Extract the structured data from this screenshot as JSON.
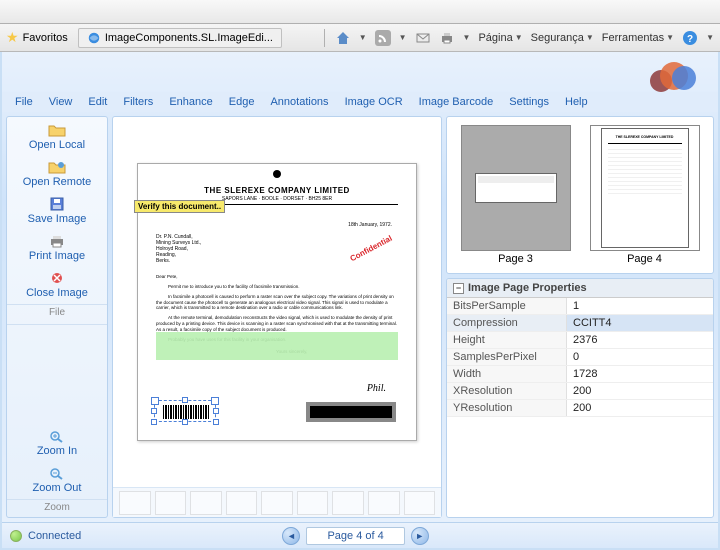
{
  "browser": {
    "favorites_label": "Favoritos",
    "tab_title": "ImageComponents.SL.ImageEdi...",
    "toolbar": {
      "page": "Página",
      "security": "Segurança",
      "tools": "Ferramentas"
    }
  },
  "app": {
    "menu": [
      "File",
      "View",
      "Edit",
      "Filters",
      "Enhance",
      "Edge",
      "Annotations",
      "Image OCR",
      "Image Barcode",
      "Settings",
      "Help"
    ],
    "sidebar": {
      "open_local": "Open Local",
      "open_remote": "Open Remote",
      "save_image": "Save Image",
      "print_image": "Print Image",
      "close_image": "Close Image",
      "group_file": "File",
      "zoom_in": "Zoom In",
      "zoom_out": "Zoom Out",
      "group_zoom": "Zoom"
    },
    "document": {
      "company": "THE SLEREXE COMPANY LIMITED",
      "addr_line": "SAPORS LANE · BOOLE · DORSET · BH25 8ER",
      "annotation": "Verify this document..",
      "date": "18th January, 1972.",
      "to": "Dr. P.N. Cundall,\nMining Surveys Ltd.,\nHolroyd Road,\nReading,\nBerks.",
      "stamp": "Confidential",
      "greeting": "Dear Pete,",
      "para1": "Permit me to introduce you to the facility of facsimile transmission.",
      "para2": "In facsimile a photocell is caused to perform a raster scan over the subject copy. The variations of print density on the document cause the photocell to generate an analogous electrical video signal. This signal is used to modulate a carrier, which is transmitted to a remote destination over a radio or cable communications link.",
      "para3": "At the remote terminal, demodulation reconstructs the video signal, which is used to modulate the density of print produced by a printing device. This device is scanning in a raster scan synchronised with that at the transmitting terminal. As a result, a facsimile copy of the subject document is produced.",
      "para4": "Probably you have uses for this facility in your organisation.",
      "closing": "Yours sincerely,",
      "signature": "Phil."
    },
    "thumbs": [
      {
        "label": "Page 3"
      },
      {
        "label": "Page 4"
      }
    ],
    "properties": {
      "header": "Image Page Properties",
      "rows": [
        {
          "k": "BitsPerSample",
          "v": "1"
        },
        {
          "k": "Compression",
          "v": "CCITT4",
          "sel": true
        },
        {
          "k": "Height",
          "v": "2376"
        },
        {
          "k": "SamplesPerPixel",
          "v": "0"
        },
        {
          "k": "Width",
          "v": "1728"
        },
        {
          "k": "XResolution",
          "v": "200"
        },
        {
          "k": "YResolution",
          "v": "200"
        }
      ]
    },
    "status": {
      "connected": "Connected",
      "page_label": "Page 4 of 4"
    }
  }
}
